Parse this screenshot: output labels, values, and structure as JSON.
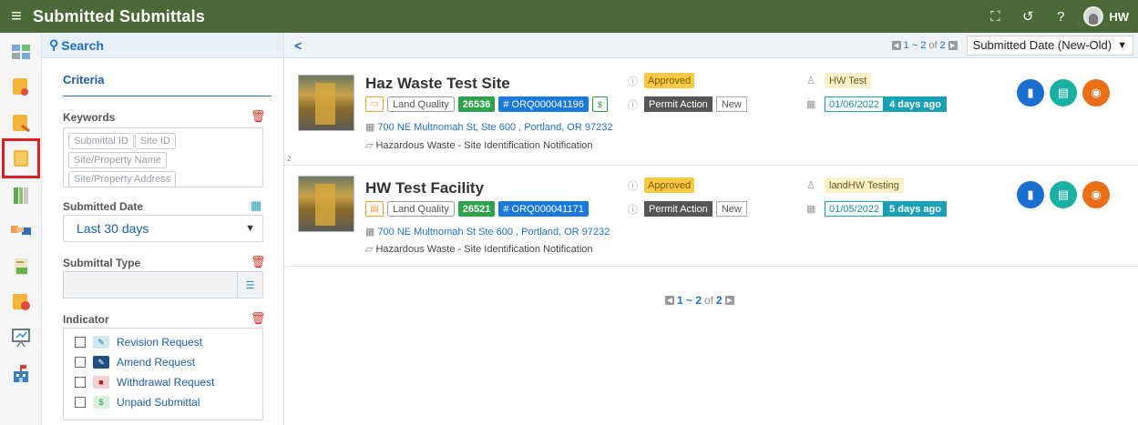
{
  "header": {
    "title": "Submitted Submittals",
    "user_initials": "HW"
  },
  "filters": {
    "search_label": "Search",
    "criteria_label": "Criteria",
    "keywords_label": "Keywords",
    "keyword_chips": [
      "Submittal ID",
      "Site ID",
      "Site/Property Name",
      "Site/Property Address"
    ],
    "submitted_date_label": "Submitted Date",
    "submitted_date_value": "Last 30 days",
    "submittal_type_label": "Submittal Type",
    "indicator_label": "Indicator",
    "indicators": [
      {
        "label": "Revision Request",
        "icon": "pencil-icon",
        "color": "#cfe9f0"
      },
      {
        "label": "Amend Request",
        "icon": "edit-icon",
        "color": "#1f4e85"
      },
      {
        "label": "Withdrawal Request",
        "icon": "folder-icon",
        "color": "#f5d0d0"
      },
      {
        "label": "Unpaid Submittal",
        "icon": "dollar-icon",
        "color": "#d8f0dc"
      }
    ]
  },
  "toolbar": {
    "back": "<",
    "page_range": "1 ~ 2",
    "page_of": "of",
    "page_total": "2",
    "sort_value": "Submitted Date (New-Old)"
  },
  "cards": [
    {
      "title": "Haz Waste Test Site",
      "program": "Land Quality",
      "site_id": "26536",
      "submittal_no": "# ORQ000041196",
      "address": "700 NE Multnomah St, Ste 600 , Portland, OR 97232",
      "submittal_type": "Hazardous Waste - Site Identification Notification",
      "status": "Approved",
      "action": "Permit Action",
      "action_type": "New",
      "submitter": "HW Test",
      "date": "01/06/2022",
      "ago": "4 days ago",
      "row_num": "2"
    },
    {
      "title": "HW Test Facility",
      "program": "Land Quality",
      "site_id": "26521",
      "submittal_no": "# ORQ000041171",
      "address": "700 NE Multnomah St Ste 600 , Portland, OR 97232",
      "submittal_type": "Hazardous Waste - Site Identification Notification",
      "status": "Approved",
      "action": "Permit Action",
      "action_type": "New",
      "submitter": "landHW Testing",
      "date": "01/05/2022",
      "ago": "5 days ago"
    }
  ],
  "bottom_pager": {
    "range": "1 ~ 2",
    "of": "of",
    "total": "2"
  }
}
